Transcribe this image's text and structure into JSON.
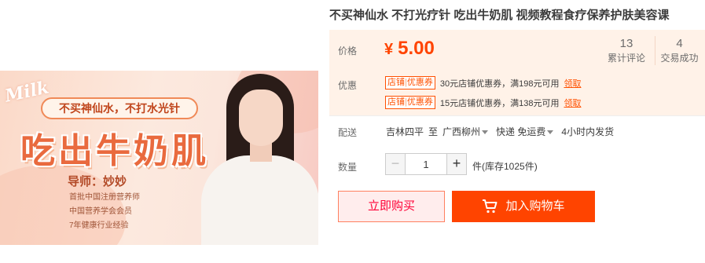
{
  "product": {
    "title": "不买神仙水 不打光疗针 吃出牛奶肌 视频教程食疗保养护肤美容课"
  },
  "image": {
    "logo_text": "Milk",
    "banner": "不买神仙水，不打水光针",
    "main_title": "吃出牛奶肌",
    "teacher": "导师：妙妙",
    "credentials": [
      "首批中国注册营养师",
      "中国营养学会会员",
      "7年健康行业经验"
    ]
  },
  "price": {
    "label": "价格",
    "currency": "¥",
    "value": "5.00",
    "color": "#ff4400"
  },
  "stats": {
    "comments_count": "13",
    "comments_label": "累计评论",
    "deals_count": "4",
    "deals_label": "交易成功"
  },
  "promotions": {
    "label": "优惠",
    "coupons": [
      {
        "badge_left": "店铺",
        "badge_right": "优惠券",
        "text": "30元店铺优惠券，满198元可用",
        "claim": "领取"
      },
      {
        "badge_left": "店铺",
        "badge_right": "优惠券",
        "text": "15元店铺优惠券，满138元可用",
        "claim": "领取"
      }
    ]
  },
  "shipping": {
    "label": "配送",
    "from": "吉林四平",
    "to_word": "至",
    "destination": "广西柳州",
    "method": "快递 免运费",
    "dispatch": "4小时内发货"
  },
  "quantity": {
    "label": "数量",
    "minus": "−",
    "value": "1",
    "plus": "+",
    "stock": "件(库存1025件)"
  },
  "actions": {
    "buy_now": "立即购买",
    "add_to_cart": "加入购物车"
  },
  "icons": {
    "cart": "cart-icon",
    "dropdown": "chevron-down-icon"
  }
}
